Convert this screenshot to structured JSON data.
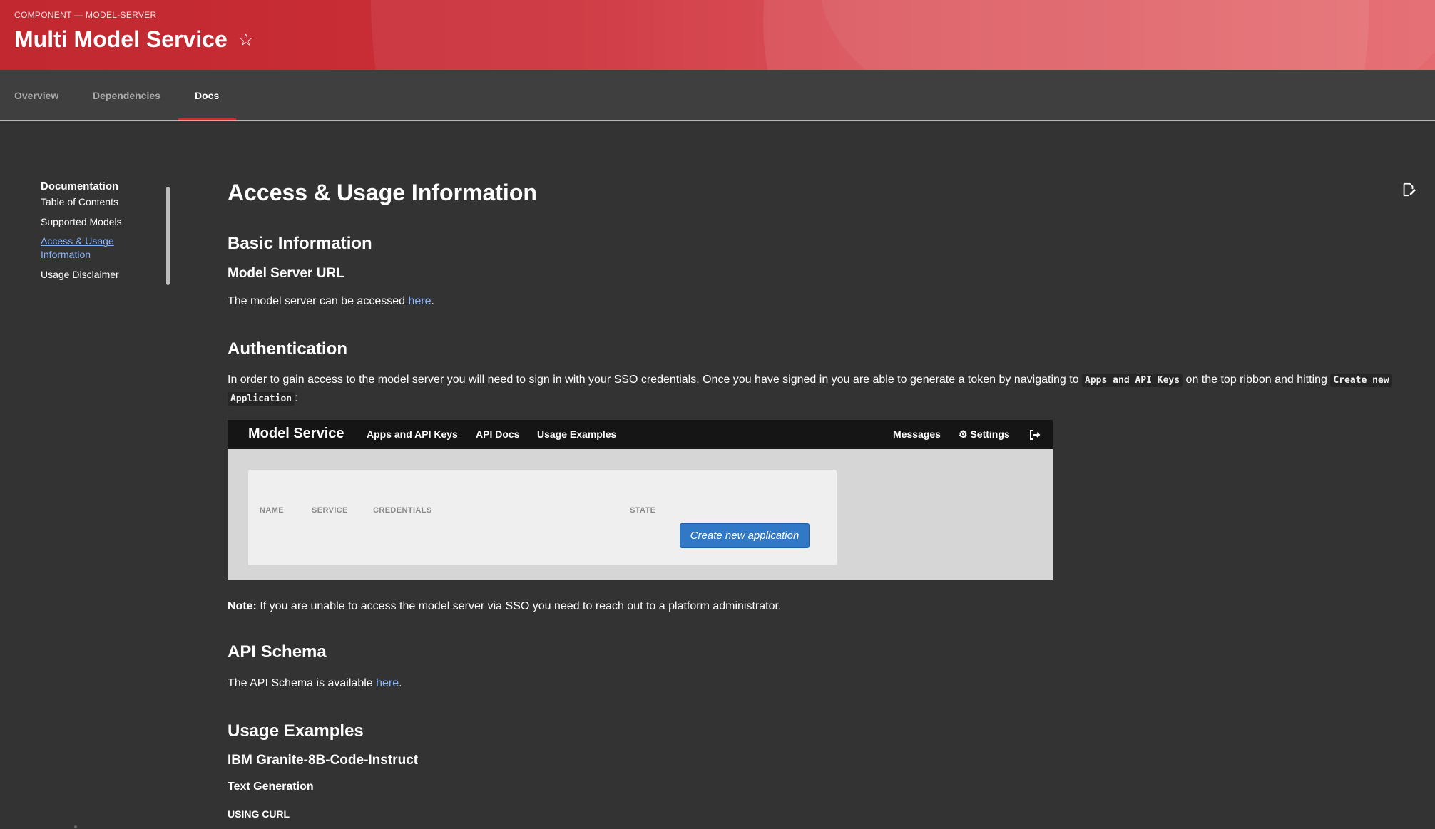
{
  "header": {
    "breadcrumb": "COMPONENT — MODEL-SERVER",
    "title": "Multi Model Service",
    "star_icon": "star-icon"
  },
  "tabs": [
    {
      "label": "Overview"
    },
    {
      "label": "Dependencies"
    },
    {
      "label": "Docs"
    }
  ],
  "active_tab": "Docs",
  "sidebar": {
    "heading": "Documentation",
    "items": [
      {
        "label": "Table of Contents"
      },
      {
        "label": "Supported Models"
      },
      {
        "label": "Access & Usage"
      },
      {
        "label": "Information"
      },
      {
        "label": "Usage Disclaimer"
      }
    ]
  },
  "content": {
    "title": "Access & Usage Information",
    "basic_info_heading": "Basic Information",
    "model_server_url_heading": "Model Server URL",
    "model_server_text_pre": "The model server can be accessed ",
    "here_link": "here",
    "period": ".",
    "auth_heading": "Authentication",
    "auth_text_1": "In order to gain access to the model server you will need to sign in with your SSO credentials. Once you have signed in you are able to generate a token by navigating to ",
    "auth_code_1": "Apps and API Keys",
    "auth_text_2": " on the top ribbon and hitting ",
    "auth_code_2a": "Create new",
    "auth_code_2b": "Application",
    "auth_text_3": ":",
    "note_label": "Note:",
    "note_text": " If you are unable to access the model server via SSO you need to reach out to a platform administrator.",
    "api_schema_heading": "API Schema",
    "api_schema_text_pre": "The API Schema is available ",
    "usage_examples_heading": "Usage Examples",
    "model_heading": "IBM Granite-8B-Code-Instruct",
    "text_gen_heading": "Text Generation",
    "using_curl_heading": "USING CURL"
  },
  "embedded_screenshot": {
    "brand": "Model Service",
    "nav": [
      "Apps and API Keys",
      "API Docs",
      "Usage Examples"
    ],
    "right_nav": [
      "Messages",
      "Settings"
    ],
    "columns": [
      "NAME",
      "SERVICE",
      "CREDENTIALS",
      "STATE"
    ],
    "button": "Create new application"
  },
  "colors": {
    "header_red": "#c1282f",
    "background": "#333333",
    "link": "#8ab4f8",
    "tab_underline": "#c9302c",
    "button_blue": "#3178c6"
  }
}
